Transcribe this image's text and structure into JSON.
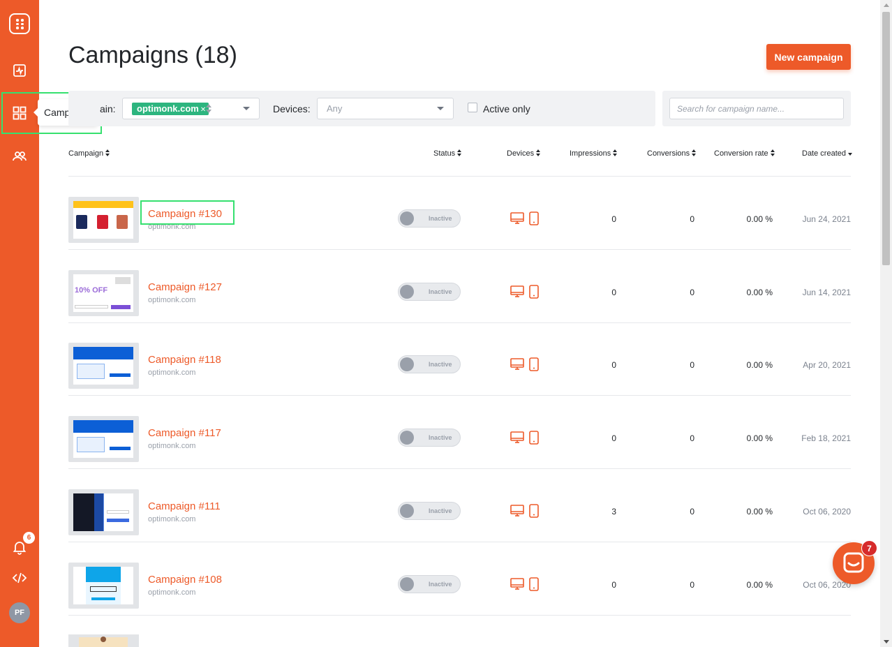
{
  "sidebar": {
    "tooltip": "Campaigns",
    "notifications_count": "6",
    "avatar_initials": "PF"
  },
  "page": {
    "title": "Campaigns (18)",
    "new_button": "New campaign"
  },
  "filters": {
    "domain_label": "Domain:",
    "domain_label_visible": "ain:",
    "domain_tag": "optimonk.com",
    "devices_label": "Devices:",
    "devices_value": "Any",
    "active_only_label": "Active only",
    "search_placeholder": "Search for campaign name..."
  },
  "table": {
    "columns": {
      "campaign": "Campaign",
      "status": "Status",
      "devices": "Devices",
      "impressions": "Impressions",
      "conversions": "Conversions",
      "conversion_rate": "Conversion rate",
      "date_created": "Date created"
    },
    "status_label": "Inactive",
    "rows": [
      {
        "name": "Campaign #130",
        "domain": "optimonk.com",
        "impressions": "0",
        "conversions": "0",
        "rate": "0.00 %",
        "date": "Jun 24, 2021"
      },
      {
        "name": "Campaign #127",
        "domain": "optimonk.com",
        "impressions": "0",
        "conversions": "0",
        "rate": "0.00 %",
        "date": "Jun 14, 2021"
      },
      {
        "name": "Campaign #118",
        "domain": "optimonk.com",
        "impressions": "0",
        "conversions": "0",
        "rate": "0.00 %",
        "date": "Apr 20, 2021"
      },
      {
        "name": "Campaign #117",
        "domain": "optimonk.com",
        "impressions": "0",
        "conversions": "0",
        "rate": "0.00 %",
        "date": "Feb 18, 2021"
      },
      {
        "name": "Campaign #111",
        "domain": "optimonk.com",
        "impressions": "3",
        "conversions": "0",
        "rate": "0.00 %",
        "date": "Oct 06, 2020"
      },
      {
        "name": "Campaign #108",
        "domain": "optimonk.com",
        "impressions": "0",
        "conversions": "0",
        "rate": "0.00 %",
        "date": "Oct 06, 2020"
      }
    ]
  },
  "chat": {
    "badge": "7"
  },
  "colors": {
    "brand": "#ed5a29",
    "tag": "#2db57f",
    "highlight": "#35e06f"
  }
}
